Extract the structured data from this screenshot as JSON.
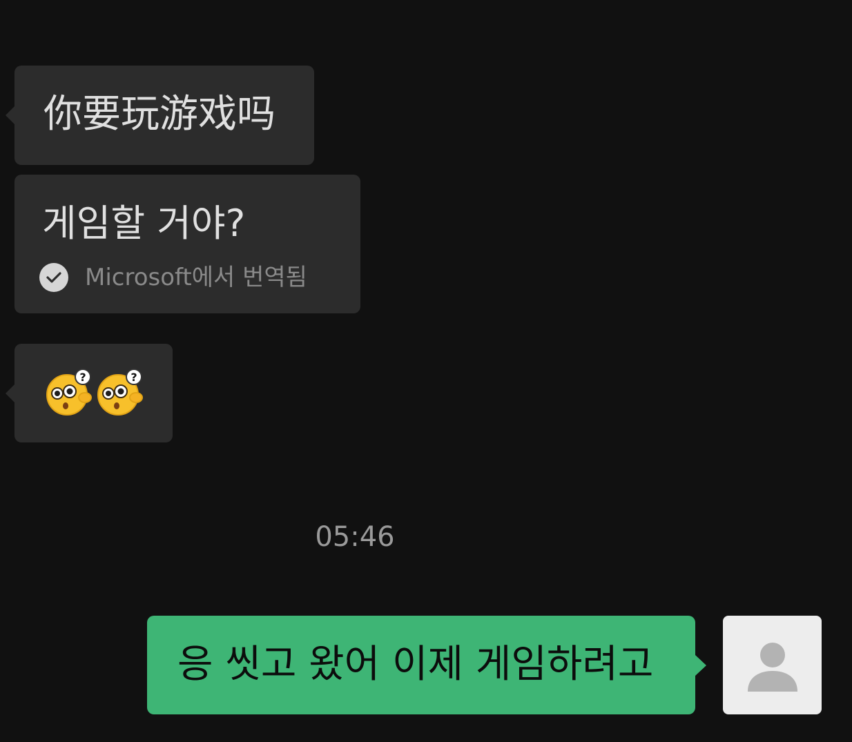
{
  "messages": [
    {
      "direction": "incoming",
      "text": "你要玩游戏吗"
    },
    {
      "direction": "incoming",
      "text": "게임할 거야?",
      "translation_note": "Microsoft에서 번역됨",
      "translation_icon": "check-circle-icon"
    },
    {
      "direction": "incoming",
      "emojis": [
        "face-with-question-mark-emoji",
        "face-with-question-mark-emoji"
      ]
    },
    {
      "direction": "outgoing",
      "text": "응 씻고 왔어 이제 게임하려고",
      "avatar": "default-user-avatar-icon"
    }
  ],
  "timestamp": "05:46",
  "colors": {
    "background": "#111111",
    "incoming_bubble": "#2c2c2c",
    "outgoing_bubble": "#3eb575",
    "muted_text": "#8a8a8a"
  }
}
